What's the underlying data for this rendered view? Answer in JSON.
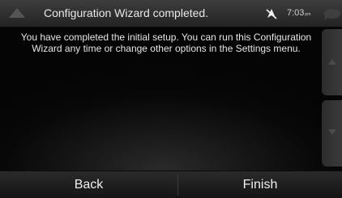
{
  "header": {
    "title": "Configuration Wizard completed.",
    "time": "7:03",
    "ampm": "pm"
  },
  "message": "You have completed the initial setup. You can run this Configuration Wizard any time or change other options in the Settings menu.",
  "footer": {
    "back_label": "Back",
    "finish_label": "Finish"
  },
  "colors": {
    "background": "#000000",
    "text": "#e6e6e6",
    "bar": "#2a2a2a"
  }
}
